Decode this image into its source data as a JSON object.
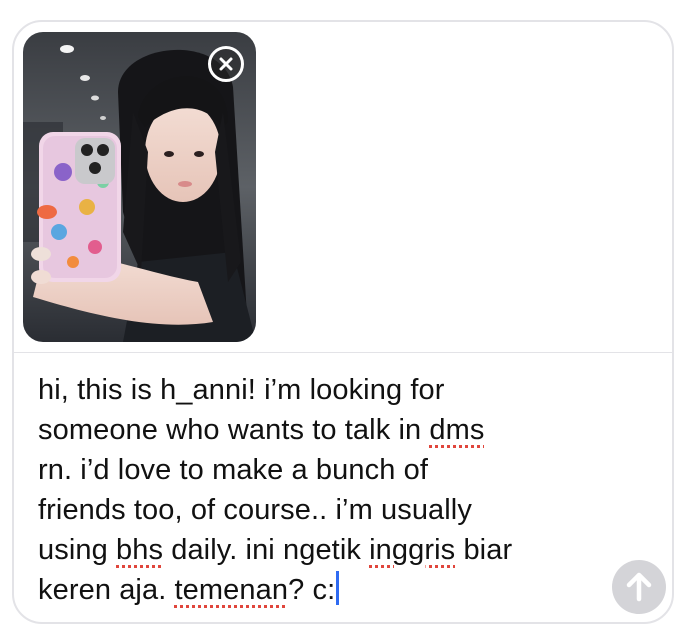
{
  "compose": {
    "message_lines": [
      [
        {
          "text": "hi, this is h_anni! i’m looking for"
        }
      ],
      [
        {
          "text": "someone who wants to talk in "
        },
        {
          "text": "dms",
          "flag": true
        }
      ],
      [
        {
          "text": "rn. i’d love to make a bunch of"
        }
      ],
      [
        {
          "text": "friends too, of course.. i’m usually"
        }
      ],
      [
        {
          "text": "using "
        },
        {
          "text": "bhs",
          "flag": true
        },
        {
          "text": " daily. ini ngetik "
        },
        {
          "text": "inggris",
          "flag": true
        },
        {
          "text": " biar"
        }
      ],
      [
        {
          "text": "keren aja. "
        },
        {
          "text": "temenan",
          "flag": true
        },
        {
          "text": "? c:"
        }
      ]
    ]
  },
  "attachment": {
    "remove_icon": "close-icon",
    "type": "photo"
  },
  "send_button": {
    "icon": "arrow-up-icon",
    "enabled": false
  },
  "colors": {
    "border": "#e3e3e7",
    "caret": "#2f6bf2",
    "spellcheck": "#e0463c",
    "send_disabled": "#d4d4d8"
  }
}
